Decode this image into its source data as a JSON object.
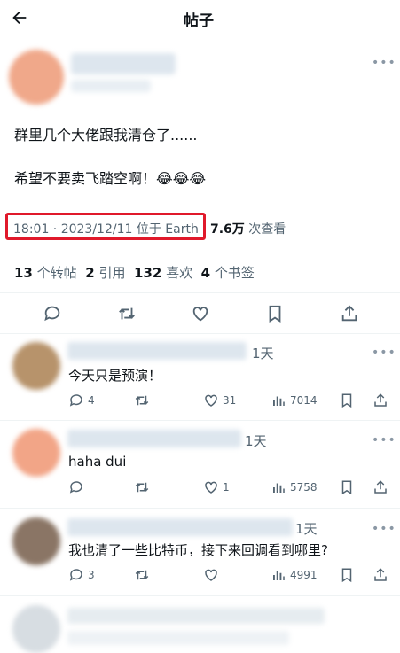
{
  "header": {
    "title": "帖子"
  },
  "post": {
    "line1": "群里几个大佬跟我清仓了......",
    "line2": "希望不要卖飞踏空啊！",
    "emoji": "😂😂😂",
    "timestamp": "18:01 · 2023/12/11 位于 Earth",
    "views_count": "7.6万",
    "views_label": "次查看",
    "stats": {
      "reposts_count": "13",
      "reposts_label": "个转帖",
      "quotes_count": "2",
      "quotes_label": "引用",
      "likes_count": "132",
      "likes_label": "喜欢",
      "bookmarks_count": "4",
      "bookmarks_label": "个书签"
    }
  },
  "replies": [
    {
      "time": "1天",
      "text": "今天只是预演！",
      "replies": "4",
      "likes": "31",
      "views": "7014"
    },
    {
      "time": "1天",
      "text": "haha dui",
      "replies": "",
      "likes": "1",
      "views": "5758"
    },
    {
      "time": "1天",
      "text": "我也清了一些比特币，接下来回调看到哪里?",
      "replies": "3",
      "likes": "",
      "views": "4991"
    }
  ],
  "colors": {
    "highlight_box": "#e0192b",
    "muted": "#536471",
    "text": "#0f1419"
  },
  "icons": [
    "back-arrow-icon",
    "more-icon",
    "reply-icon",
    "retweet-icon",
    "like-icon",
    "bookmark-icon",
    "share-icon",
    "views-icon"
  ]
}
